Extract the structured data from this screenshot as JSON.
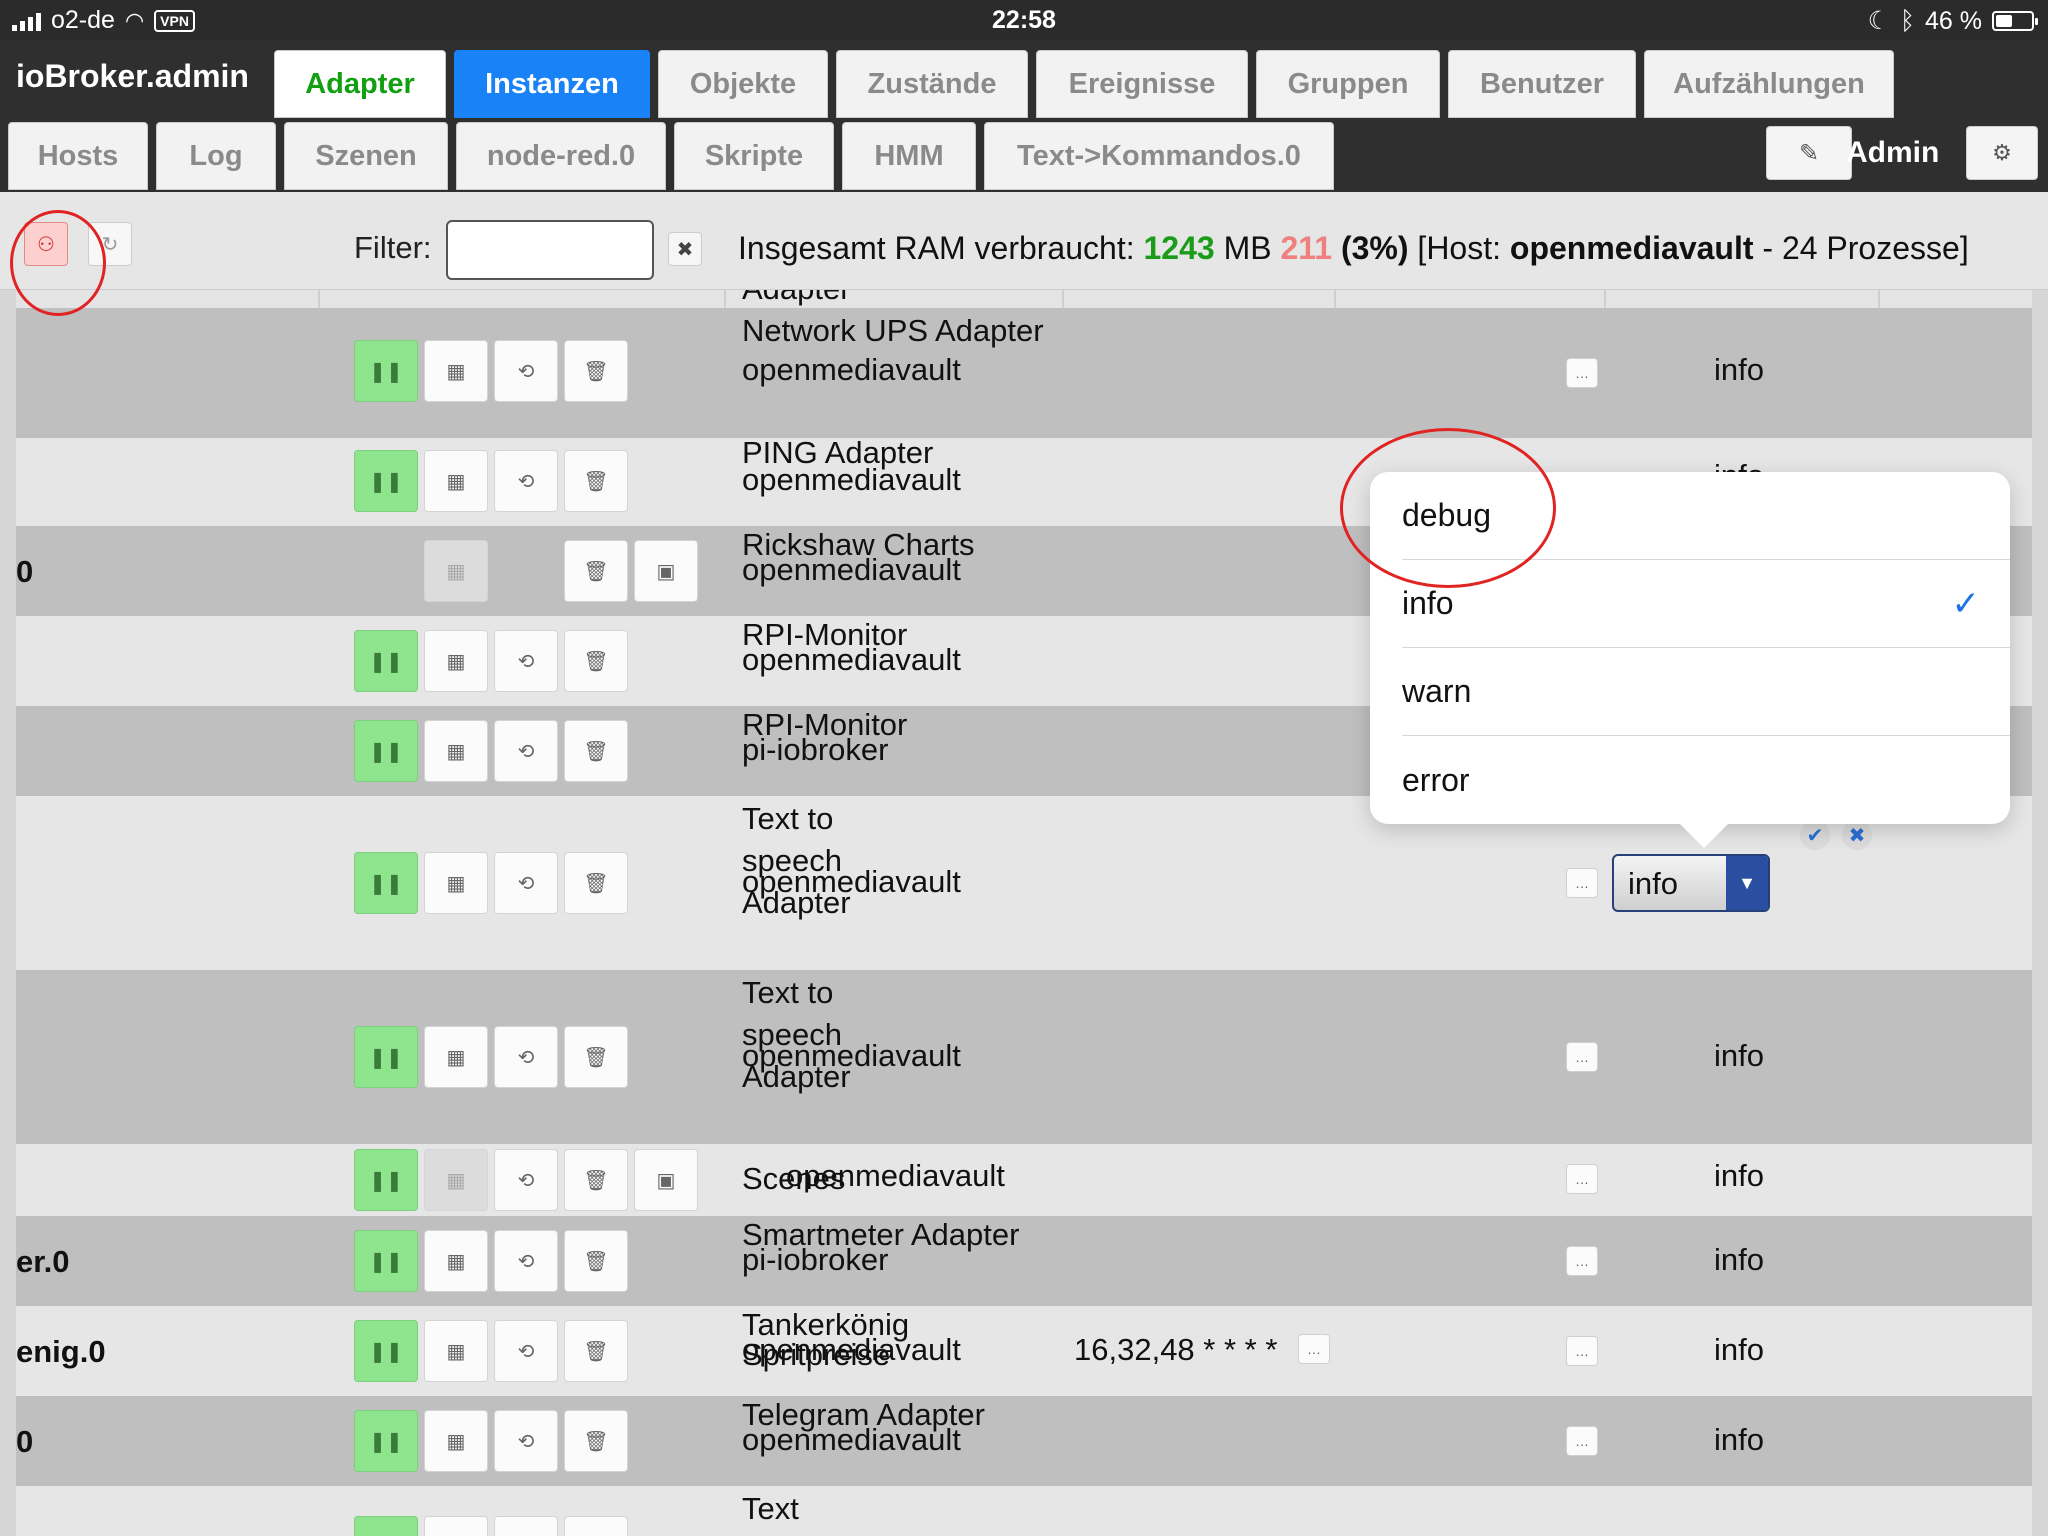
{
  "status_bar": {
    "carrier": "o2-de",
    "vpn": "VPN",
    "time": "22:58",
    "battery": "46 %",
    "battery_level": 0.46
  },
  "app": {
    "title": "ioBroker.admin"
  },
  "tabs_row1": [
    "Adapter",
    "Instanzen",
    "Objekte",
    "Zustände",
    "Ereignisse",
    "Gruppen",
    "Benutzer",
    "Aufzählungen"
  ],
  "tabs_row2": [
    "Hosts",
    "Log",
    "Szenen",
    "node-red.0",
    "Skripte",
    "HMM",
    "Text->Kommandos.0"
  ],
  "active_tab": "Instanzen",
  "header": {
    "user": "Admin"
  },
  "toolbar": {
    "filter_label": "Filter:",
    "filter_value": "",
    "ram_prefix": "Insgesamt RAM verbraucht:",
    "ram_total": "1243",
    "ram_unit": "MB",
    "ram_free": "211",
    "ram_percent": "(3%)",
    "host_prefix": "[Host:",
    "host_name": "openmediavault",
    "host_suffix": "- 24 Prozesse]"
  },
  "rows": [
    {
      "id": "",
      "name": "Network UPS Adapter",
      "host": "openmediavault",
      "schedule": "",
      "level": "info"
    },
    {
      "id": "",
      "name": "PING Adapter",
      "host": "openmediavault",
      "schedule": "",
      "level": "info"
    },
    {
      "id": "0",
      "name": "Rickshaw Charts",
      "host": "openmediavault",
      "schedule": "",
      "level": ""
    },
    {
      "id": "",
      "name": "RPI-Monitor",
      "host": "openmediavault",
      "schedule": "",
      "level": ""
    },
    {
      "id": "",
      "name": "RPI-Monitor",
      "host": "pi-iobroker",
      "schedule": "",
      "level": ""
    },
    {
      "id": "",
      "name": "Text to speech Adapter",
      "host": "openmediavault",
      "schedule": "",
      "level": "info"
    },
    {
      "id": "",
      "name": "Text to speech Adapter",
      "host": "openmediavault",
      "schedule": "",
      "level": "info"
    },
    {
      "id": "",
      "name": "Scenes",
      "host": "openmediavault",
      "schedule": "",
      "level": "info"
    },
    {
      "id": "er.0",
      "name": "Smartmeter Adapter",
      "host": "pi-iobroker",
      "schedule": "",
      "level": "info"
    },
    {
      "id": "enig.0",
      "name": "Tankerkönig Spritpreise",
      "host": "openmediavault",
      "schedule": "16,32,48 * * * *",
      "level": "info"
    },
    {
      "id": "0",
      "name": "Telegram Adapter",
      "host": "openmediavault",
      "schedule": "",
      "level": "info"
    },
    {
      "id": "",
      "name": "Text",
      "host": "",
      "schedule": "",
      "level": ""
    }
  ],
  "partial_top_text": "Adapter",
  "log_level_select": {
    "value": "info"
  },
  "popover": {
    "options": [
      "debug",
      "info",
      "warn",
      "error"
    ],
    "selected": "info",
    "check": "✓"
  },
  "icons": {
    "pause": "pause-icon",
    "stop": "stop-icon",
    "restart": "restart-icon",
    "delete": "trash-icon",
    "image": "image-icon",
    "more": "ellipsis-icon"
  },
  "colors": {
    "active_tab": "#1a82f7",
    "green_tab_text": "#12a012",
    "ram_total": "#1a9c1a",
    "ram_free": "#f08080",
    "play_button": "#8ee58e",
    "annotation": "#e02424"
  }
}
